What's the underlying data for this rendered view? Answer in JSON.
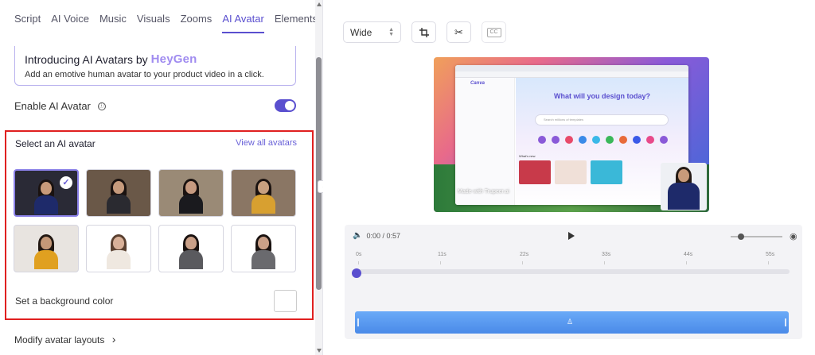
{
  "tabs": [
    "Script",
    "AI Voice",
    "Music",
    "Visuals",
    "Zooms",
    "AI Avatar",
    "Elements"
  ],
  "active_tab": "AI Avatar",
  "promo": {
    "title": "Introducing AI Avatars by",
    "brand": "HeyGen",
    "subtitle": "Add an emotive human avatar to your product video in a click."
  },
  "enable_avatar": {
    "label": "Enable AI Avatar",
    "info_icon": "ⓘ",
    "enabled": true
  },
  "avatar_section": {
    "title": "Select an AI avatar",
    "view_all": "View all avatars",
    "selected_index": 0,
    "avatars": [
      {
        "bg": "#2a2a36",
        "skin": "#c89a7a",
        "hair": "#1a1210",
        "top": "#1e2a6a"
      },
      {
        "bg": "#6a5848",
        "skin": "#c59a7c",
        "hair": "#1a1210",
        "top": "#2a2a30"
      },
      {
        "bg": "#9a8a76",
        "skin": "#c69a80",
        "hair": "#1a1210",
        "top": "#1a1a1e"
      },
      {
        "bg": "#8a7664",
        "skin": "#c8a080",
        "hair": "#1a1210",
        "top": "#d8a030"
      },
      {
        "bg": "#e8e4e0",
        "skin": "#c49878",
        "hair": "#221812",
        "top": "#e0a020"
      },
      {
        "bg": "#ffffff",
        "skin": "#d8b098",
        "hair": "#5a4030",
        "top": "#efe8e0"
      },
      {
        "bg": "#ffffff",
        "skin": "#caa088",
        "hair": "#1a1210",
        "top": "#5a5a5e"
      },
      {
        "bg": "#ffffff",
        "skin": "#caa088",
        "hair": "#1a1210",
        "top": "#6a6a6e"
      }
    ],
    "background_label": "Set a background color",
    "background_color": "#ffffff"
  },
  "modify_layouts": "Modify avatar layouts",
  "modify_chevron": "›",
  "collapse_icon": "‹",
  "toolbar": {
    "aspect_label": "Wide",
    "crop_icon": "⌗",
    "cut_icon": "✂",
    "cc_label": "CC"
  },
  "preview": {
    "design_title": "What will you design today?",
    "search_placeholder": "Search millions of templates",
    "whats_new": "What's new",
    "watermark": "Made with Trupeer.ai",
    "logo": "Canva"
  },
  "timeline": {
    "time": "0:00 / 0:57",
    "ticks": [
      "0s",
      "11s",
      "22s",
      "33s",
      "44s",
      "55s"
    ],
    "progress": 0,
    "eye_icon": "◉",
    "speaker_icon": "🔈"
  },
  "colors": {
    "accent": "#5a4fcf",
    "track": "#4a8ae8",
    "highlight_border": "#e02020"
  }
}
